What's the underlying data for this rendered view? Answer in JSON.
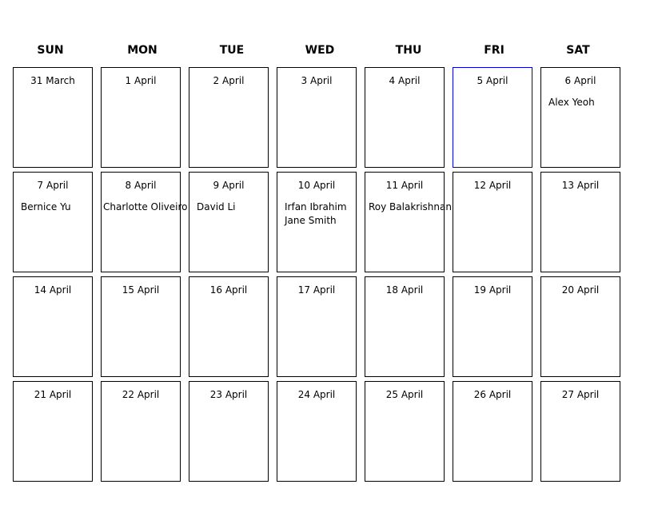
{
  "calendar": {
    "weekdays": [
      "SUN",
      "MON",
      "TUE",
      "WED",
      "THU",
      "FRI",
      "SAT"
    ],
    "weeks": [
      [
        {
          "date": "31 March",
          "events": []
        },
        {
          "date": "1 April",
          "events": []
        },
        {
          "date": "2 April",
          "events": []
        },
        {
          "date": "3 April",
          "events": []
        },
        {
          "date": "4 April",
          "events": []
        },
        {
          "date": "5 April",
          "events": [],
          "selected": true
        },
        {
          "date": "6 April",
          "events": [
            "Alex Yeoh"
          ]
        }
      ],
      [
        {
          "date": "7 April",
          "events": [
            "Bernice Yu"
          ]
        },
        {
          "date": "8 April",
          "events": [
            "Charlotte Oliveiro"
          ]
        },
        {
          "date": "9 April",
          "events": [
            "David Li"
          ]
        },
        {
          "date": "10 April",
          "events": [
            "Irfan Ibrahim",
            "Jane Smith"
          ]
        },
        {
          "date": "11 April",
          "events": [
            "Roy Balakrishnan"
          ]
        },
        {
          "date": "12 April",
          "events": []
        },
        {
          "date": "13 April",
          "events": []
        }
      ],
      [
        {
          "date": "14 April",
          "events": []
        },
        {
          "date": "15 April",
          "events": []
        },
        {
          "date": "16 April",
          "events": []
        },
        {
          "date": "17 April",
          "events": []
        },
        {
          "date": "18 April",
          "events": []
        },
        {
          "date": "19 April",
          "events": []
        },
        {
          "date": "20 April",
          "events": []
        }
      ],
      [
        {
          "date": "21 April",
          "events": []
        },
        {
          "date": "22 April",
          "events": []
        },
        {
          "date": "23 April",
          "events": []
        },
        {
          "date": "24 April",
          "events": []
        },
        {
          "date": "25 April",
          "events": []
        },
        {
          "date": "26 April",
          "events": []
        },
        {
          "date": "27 April",
          "events": []
        }
      ]
    ]
  }
}
